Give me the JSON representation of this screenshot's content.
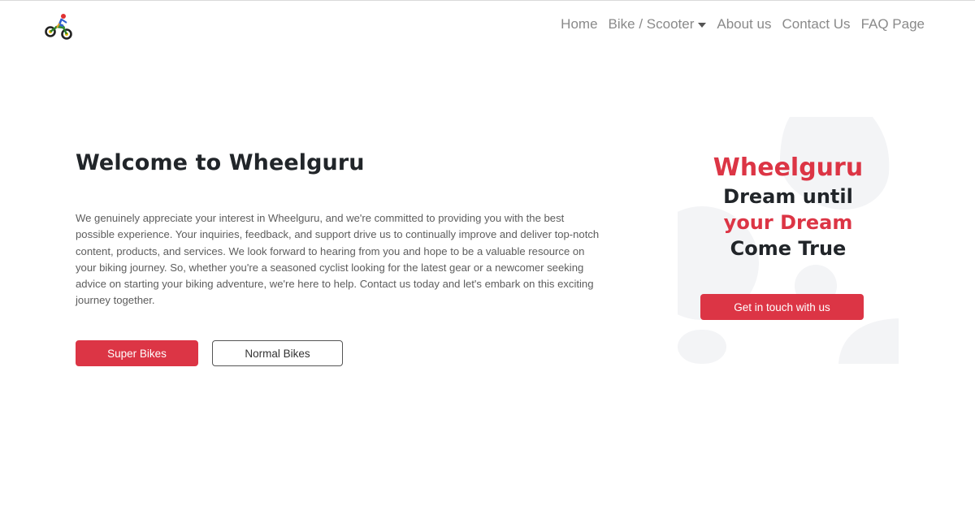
{
  "nav": {
    "links": [
      {
        "label": "Home"
      },
      {
        "label": "Bike / Scooter"
      },
      {
        "label": "About us"
      },
      {
        "label": "Contact Us"
      },
      {
        "label": "FAQ Page"
      }
    ]
  },
  "hero": {
    "title": "Welcome to Wheelguru",
    "text": "We genuinely appreciate your interest in Wheelguru, and we're committed to providing you with the best possible experience. Your inquiries, feedback, and support drive us to continually improve and deliver top-notch content, products, and services. We look forward to hearing from you and hope to be a valuable resource on your biking journey. So, whether you're a seasoned cyclist looking for the latest gear or a newcomer seeking advice on starting your biking adventure, we're here to help. Contact us today and let's embark on this exciting journey together.",
    "buttons": {
      "primary": "Super Bikes",
      "secondary": "Normal Bikes"
    }
  },
  "card": {
    "brand": "Wheelguru",
    "line1": "Dream until",
    "line2": "your Dream",
    "line3": "Come True",
    "button": "Get in touch with us"
  },
  "colors": {
    "accent": "#dc3545",
    "text": "#212529",
    "muted": "#8a8a8a"
  },
  "icons": {
    "logo": "motorbike-logo-icon",
    "dropdown": "caret-down-icon"
  }
}
